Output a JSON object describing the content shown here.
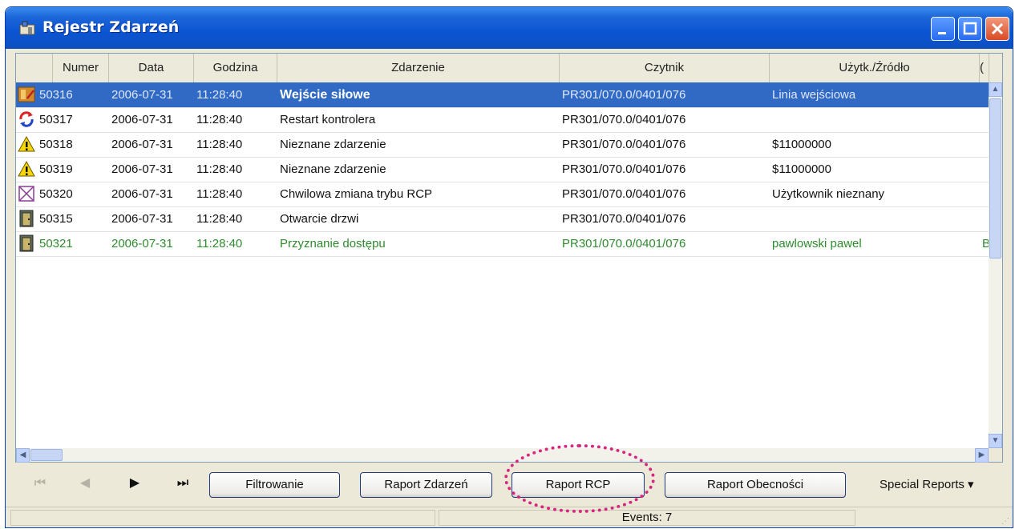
{
  "window": {
    "title": "Rejestr Zdarzeń"
  },
  "table": {
    "columns": [
      "Numer",
      "Data",
      "Godzina",
      "Zdarzenie",
      "Czytnik",
      "Użytk./Źródło",
      "("
    ],
    "rows": [
      {
        "icon": "forced-entry-icon",
        "numer": "50316",
        "data": "2006-07-31",
        "godzina": "11:28:40",
        "zdarzenie": "Wejście siłowe",
        "czytnik": "PR301/070.0/0401/076",
        "zrodlo": "Linia wejściowa",
        "extra": "",
        "selected": true
      },
      {
        "icon": "restart-icon",
        "numer": "50317",
        "data": "2006-07-31",
        "godzina": "11:28:40",
        "zdarzenie": "Restart kontrolera",
        "czytnik": "PR301/070.0/0401/076",
        "zrodlo": "",
        "extra": ""
      },
      {
        "icon": "warning-icon",
        "numer": "50318",
        "data": "2006-07-31",
        "godzina": "11:28:40",
        "zdarzenie": "Nieznane zdarzenie",
        "czytnik": "PR301/070.0/0401/076",
        "zrodlo": "$11000000",
        "extra": ""
      },
      {
        "icon": "warning-icon",
        "numer": "50319",
        "data": "2006-07-31",
        "godzina": "11:28:40",
        "zdarzenie": "Nieznane zdarzenie",
        "czytnik": "PR301/070.0/0401/076",
        "zrodlo": "$11000000",
        "extra": ""
      },
      {
        "icon": "mode-change-icon",
        "numer": "50320",
        "data": "2006-07-31",
        "godzina": "11:28:40",
        "zdarzenie": "Chwilowa zmiana trybu RCP",
        "czytnik": "PR301/070.0/0401/076",
        "zrodlo": "Użytkownik nieznany",
        "extra": ""
      },
      {
        "icon": "door-icon",
        "numer": "50315",
        "data": "2006-07-31",
        "godzina": "11:28:40",
        "zdarzenie": "Otwarcie drzwi",
        "czytnik": "PR301/070.0/0401/076",
        "zrodlo": "",
        "extra": ""
      },
      {
        "icon": "door-icon",
        "numer": "50321",
        "data": "2006-07-31",
        "godzina": "11:28:40",
        "zdarzenie": "Przyznanie dostępu",
        "czytnik": "PR301/070.0/0401/076",
        "zrodlo": "pawlowski pawel",
        "extra": "B",
        "green": true
      }
    ]
  },
  "toolbar": {
    "first": "⏮",
    "prev": "◀",
    "next": "▶",
    "last": "⏭",
    "filter_label": "Filtrowanie",
    "event_report_label": "Raport Zdarzeń",
    "rcp_report_label": "Raport RCP",
    "attendance_report_label": "Raport Obecności",
    "special_reports_label": "Special Reports ▾"
  },
  "status": {
    "events_text": "Events: 7"
  },
  "colors": {
    "selection": "#316ac5",
    "granted": "#2e8b2e",
    "highlight_circle": "#d6267f"
  }
}
